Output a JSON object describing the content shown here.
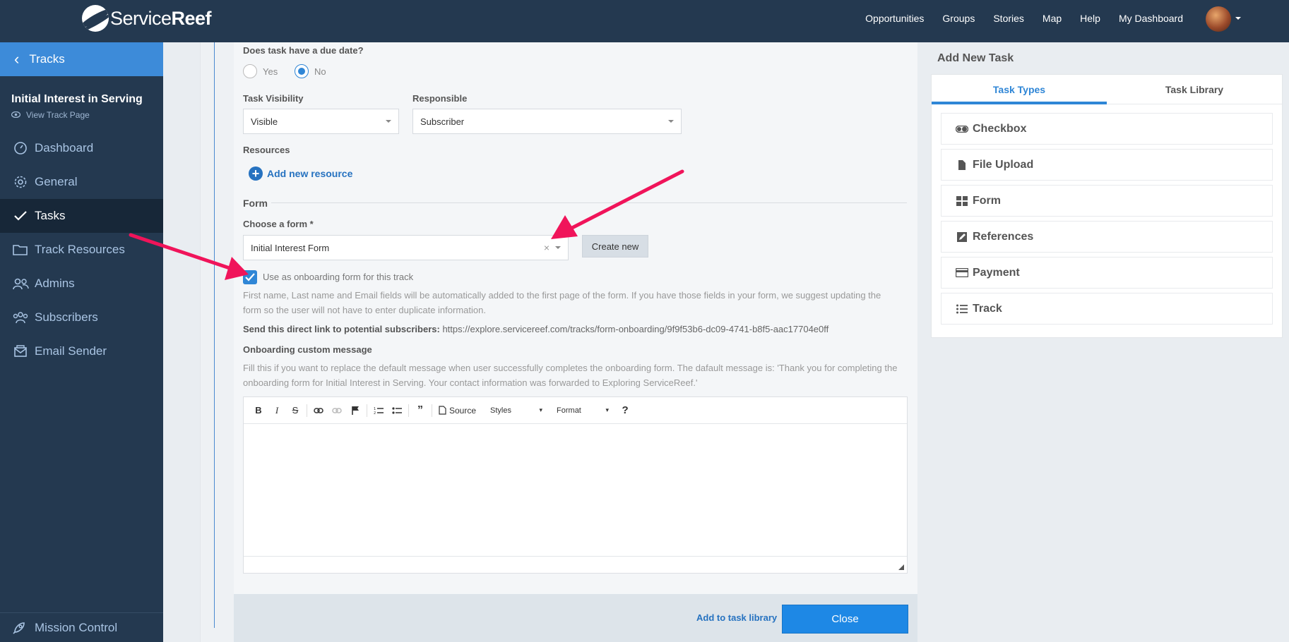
{
  "header": {
    "logo_text_light": "Service",
    "logo_text_bold": "Reef",
    "nav": [
      "Opportunities",
      "Groups",
      "Stories",
      "Map",
      "Help",
      "My Dashboard"
    ]
  },
  "sidebar": {
    "back_label": "Tracks",
    "track_title": "Initial Interest in Serving",
    "view_track_link": "View Track Page",
    "items": [
      {
        "label": "Dashboard",
        "icon": "dashboard-icon"
      },
      {
        "label": "General",
        "icon": "gear-icon"
      },
      {
        "label": "Tasks",
        "icon": "check-icon"
      },
      {
        "label": "Track Resources",
        "icon": "folder-icon"
      },
      {
        "label": "Admins",
        "icon": "admins-icon"
      },
      {
        "label": "Subscribers",
        "icon": "subscribers-icon"
      },
      {
        "label": "Email Sender",
        "icon": "envelope-icon"
      }
    ],
    "mission_control": "Mission Control"
  },
  "form": {
    "due_date_label": "Does task have a due date?",
    "due_yes": "Yes",
    "due_no": "No",
    "visibility_label": "Task Visibility",
    "visibility_value": "Visible",
    "responsible_label": "Responsible",
    "responsible_value": "Subscriber",
    "resources_label": "Resources",
    "add_resource": "Add new resource",
    "section_form": "Form",
    "choose_form_label": "Choose a form *",
    "choose_form_value": "Initial Interest Form",
    "create_new": "Create new",
    "onboarding_checkbox": "Use as onboarding form for this track",
    "onboarding_help_1": "First name, Last name and Email fields will be automatically added to the first page of the form. If you have those fields in your form, we suggest updating the",
    "onboarding_help_2": "form so the user will not have to enter duplicate information.",
    "send_link_label": "Send this direct link to potential subscribers:",
    "send_link_url": "https://explore.servicereef.com/tracks/form-onboarding/9f9f53b6-dc09-4741-b8f5-aac17704e0ff",
    "custom_message_label": "Onboarding custom message",
    "custom_message_help_1": "Fill this if you want to replace the default message when user successfully completes the onboarding form. The dafault message is: 'Thank you for completing the",
    "custom_message_help_2": "onboarding form for Initial Interest in Serving. Your contact information was forwarded to Exploring ServiceReef.'"
  },
  "editor": {
    "source_label": "Source",
    "styles_label": "Styles",
    "format_label": "Format",
    "help_label": "?"
  },
  "footer": {
    "add_to_library": "Add to task library",
    "close": "Close"
  },
  "right_panel": {
    "title": "Add New Task",
    "tabs": [
      "Task Types",
      "Task Library"
    ],
    "types": [
      {
        "label": "Checkbox",
        "icon": "toggle-icon"
      },
      {
        "label": "File Upload",
        "icon": "file-icon"
      },
      {
        "label": "Form",
        "icon": "grid-icon"
      },
      {
        "label": "References",
        "icon": "edit-icon"
      },
      {
        "label": "Payment",
        "icon": "card-icon"
      },
      {
        "label": "Track",
        "icon": "list-icon"
      }
    ]
  },
  "colors": {
    "navy": "#243950",
    "accent_blue": "#2f86d6",
    "annotation_pink": "#f0145a"
  }
}
